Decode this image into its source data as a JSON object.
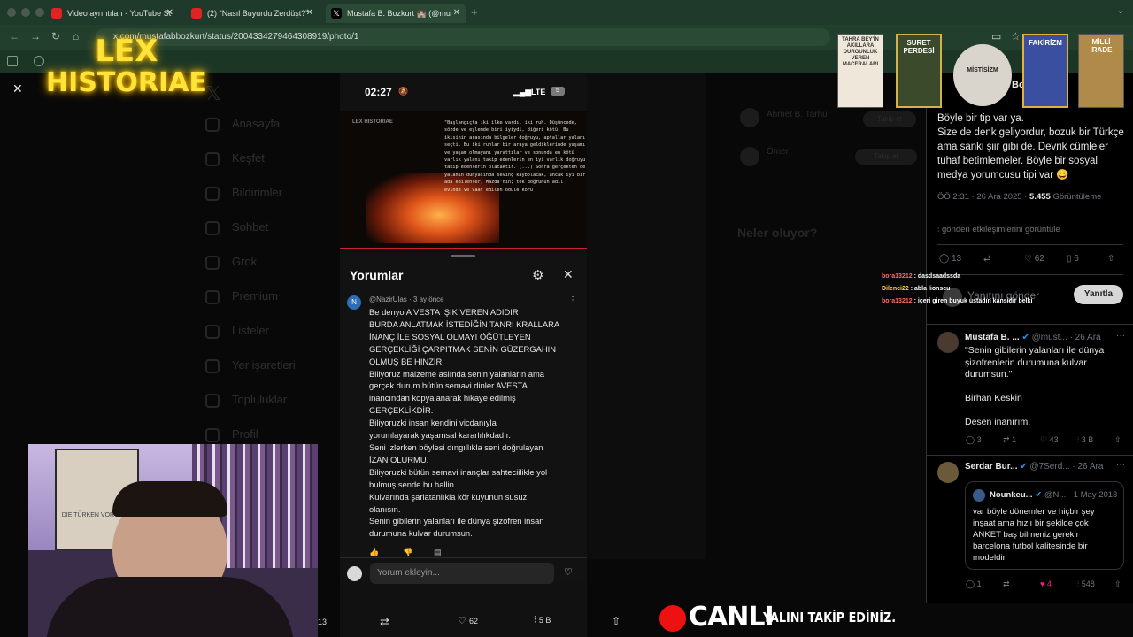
{
  "browser": {
    "tabs": [
      {
        "title": "Video ayrıntıları - YouTube St",
        "fav_color": "#e02424"
      },
      {
        "title": "(2) \"Nasıl Buyurdu Zerdüşt?\"",
        "fav_color": "#e02424"
      },
      {
        "title": "Mustafa B. Bozkurt 🏰 (@mu",
        "fav_color": "#000000"
      }
    ],
    "new_tab": "+",
    "url": "x.com/mustafabbozkurt/status/2004334279464308919/photo/1"
  },
  "overlay_logo": {
    "line1": "LEX",
    "line2": "HISTORIAE"
  },
  "book_covers": [
    {
      "title": "TAHRA BEY'İN AKILLARA DURGUNLUK VEREN MACERALARI",
      "color": "#efe8da"
    },
    {
      "title": "SURET PERDESİ",
      "color": "#3b4a2a"
    },
    {
      "title": "MİSTİSİZM",
      "color": "#d9d4cc"
    },
    {
      "title": "FAKİRİZM",
      "color": "#3b4fa0"
    },
    {
      "title": "MİLLİ İRADE",
      "color": "#b08a4a"
    }
  ],
  "sidebar_bg": [
    "Anasayfa",
    "Keşfet",
    "Bildirimler",
    "Sohbet",
    "Grok",
    "Premium",
    "Listeler",
    "Yer işaretleri",
    "Topluluklar",
    "Profil"
  ],
  "bg_right": {
    "whats_happening": "Neler oluyor?",
    "items": [
      "Ahmet B. Tarhu",
      "Ömer"
    ],
    "follow": "Takip et"
  },
  "phone": {
    "time": "02:27",
    "network": "LTE",
    "battery": "5"
  },
  "video_quote": {
    "brand": "LEX HISTORIAE",
    "text": [
      "\"Başlangıçta iki ilke vardı, iki ruh. Düşüncede,",
      "sözde ve eylemde biri iyiydi, diğeri kötü. Bu",
      "ikisinin arasında bilgeler doğruyu, aptallar yalanı",
      "seçti. Bu iki ruhlar bir araya geldiklerinde yaşamı",
      "ve yaşam olmayanı yarattılar ve sonunda en kötü",
      "varlık yalanı takip edenlerin en iyi varlık doğruyu",
      "takip edenlerin olacaktır. (...) Sonra gerçekten de",
      "yalanın dünyasında sevinç kaybolacak, ancak iyi bir",
      "ada edilenler, Mazda'nın; tek doğrunun adil",
      "evinde ve vaat edilen ödüle koru"
    ]
  },
  "comments_panel": {
    "title": "Yorumlar",
    "author": "@NazirUlas",
    "time": "3 ay önce",
    "avatar_letter": "N",
    "lines": [
      "Be denyo A VESTA IŞIK VEREN ADIDIR",
      "BURDA ANLATMAK İSTEDİĞİN TANRI KRALLARA",
      "İNANÇ İLE SOSYAL OLMAYI ÖĞÜTLEYEN",
      "GERÇEKLİĞİ ÇARPITMAK SENİN GÜZERGAHIN",
      "OLMUŞ BE HINZIR.",
      "Biliyoruz malzeme aslında senin yalanların ama",
      "gerçek durum bütün semavi dinler AVESTA",
      "inancından kopyalanarak hikaye edilmiş",
      "GERÇEKLİKDİR.",
      "Biliyoruzki insan kendini vicdanıyla",
      "yorumlayarak yaşamsal kararlılıkdadır.",
      "Seni izlerken böylesi dıngıllıkla seni doğrulayan",
      "İZAN OLURMU.",
      "Biliyoruzki bütün semavi inançlar sahteciilikle yol",
      "bulmuş sende bu hallin",
      "Kulvarında şarlatanlıkla kör kuyunun susuz",
      "olanısın.",
      "Senin gibilerin yalanları ile dünya şizofren insan",
      "durumuna kulvar durumsun."
    ],
    "add_placeholder": "Yorum ekleyin..."
  },
  "tweet_right": {
    "header_name": "Bo",
    "body": [
      "Böyle bir tip var ya.",
      "Size de denk geliyordur, bozuk bir Türkçe",
      "ama sanki şiir gibi de. Devrik cümleler",
      "tuhaf betimlemeler. Böyle bir sosyal",
      "medya yorumcusu tipi var 😀"
    ],
    "meta_time": "ÖÖ 2:31 · 26 Ara 2025 · ",
    "views": "5.455",
    "views_label": " Görüntüleme",
    "engagements": "gönderi etkileşimlerini görüntüle",
    "stats": {
      "replies": "13",
      "likes": "62",
      "bookmarks": "6"
    },
    "reply_placeholder": "Yanıtını gönder",
    "reply_button": "Yanıtla"
  },
  "chat": [
    {
      "user": "bora13212",
      "msg": "dasdsaadssda",
      "color": "#ff6b6b"
    },
    {
      "user": "Dilenci22",
      "msg": "abla lionscu",
      "color": "#ffd24a"
    },
    {
      "user": "bora13212",
      "msg": "içeri giren buyuk ustadın kansidir belki",
      "color": "#ff6b6b"
    }
  ],
  "replies": [
    {
      "name": "Mustafa B. ...",
      "handle": "@must...",
      "date": "· 26 Ara",
      "lines": [
        "\"Senin gibilerin yalanları ile dünya",
        "şizofrenlerin durumuna kulvar",
        "durumsun.\"",
        "",
        "Birhan Keskin",
        "",
        "Desen inanırım."
      ],
      "stats": {
        "replies": "3",
        "reposts": "1",
        "likes": "43",
        "views": "3 B"
      }
    },
    {
      "name": "Serdar Bur...",
      "handle": "@7Serd...",
      "date": "· 26 Ara",
      "quote": {
        "name": "Nounkeu...",
        "handle": "@N...",
        "date": "· 1 May 2013",
        "lines": [
          "var böyle dönemler ve hiçbir şey",
          "inşaat ama hızlı bir şekilde çok",
          "ANKET baş bilmeniz gerekir",
          "barcelona futbol kalitesinde bir",
          "modeldir"
        ]
      },
      "stats": {
        "replies": "1",
        "likes": "4",
        "views": "548"
      }
    }
  ],
  "bottom_bar": {
    "replies": "13",
    "likes": "62",
    "views": "5 B"
  },
  "live": {
    "label": "CANLI",
    "ticker": "YALINI TAKİP EDİNİZ."
  },
  "webcam_poster": "DIE TÜRKEN VOR WIEN"
}
